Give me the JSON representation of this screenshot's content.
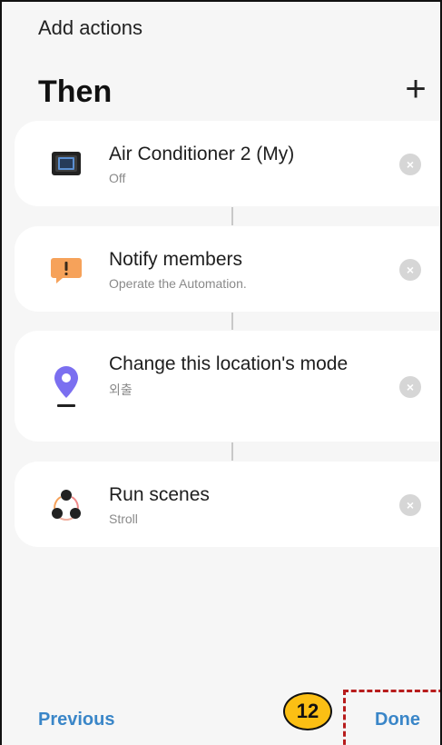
{
  "header": {
    "title": "Add actions",
    "section_title": "Then",
    "add_label": "+"
  },
  "actions": [
    {
      "title": "Air Conditioner 2 (My)",
      "subtitle": "Off",
      "icon": "air-conditioner-icon"
    },
    {
      "title": "Notify members",
      "subtitle": "Operate the Automation.",
      "icon": "notification-icon"
    },
    {
      "title": "Change this location's mode",
      "subtitle": "외출",
      "icon": "location-pin-icon"
    },
    {
      "title": "Run scenes",
      "subtitle": "Stroll",
      "icon": "scenes-icon"
    }
  ],
  "remove_label": "×",
  "footer": {
    "previous_label": "Previous",
    "done_label": "Done"
  },
  "annotation": {
    "step_number": "12"
  },
  "colors": {
    "accent": "#3a86c8",
    "background": "#f6f6f6",
    "badge": "#fbbf14",
    "highlight": "#b71c1c"
  }
}
